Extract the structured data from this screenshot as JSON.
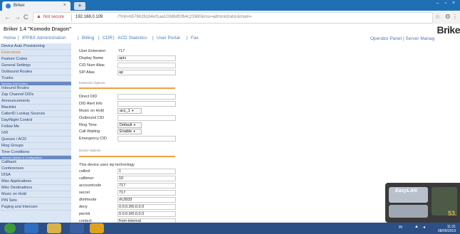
{
  "browser": {
    "tab_title": "Briker",
    "tab_close": "×",
    "new_tab": "+",
    "window_controls": "– ▫ ×",
    "nav_back": "←",
    "nav_forward": "→",
    "nav_reload": "C",
    "security_icon": "▲",
    "not_secure": "Not secure",
    "url_host": "192.168.0.109",
    "url_path": "/?mit=b576b261b4ef1aa100d6dfcf64c239d0&mu=administrator&main=",
    "star_icon": "☆",
    "account_icon": "Θ",
    "menu_icon": "⋮"
  },
  "header": {
    "app_title": "Briker 1.4 \"Komodo Dragon\"",
    "logo_text": "Brike",
    "nav": [
      {
        "label": "Home"
      },
      {
        "label": "IPPBX Administration"
      },
      {
        "label": "Billing"
      },
      {
        "label": "CDR"
      },
      {
        "label": "ACD Statistics"
      },
      {
        "label": "User Portal"
      },
      {
        "label": "Fax"
      }
    ],
    "nav_separator": "|",
    "operator_panel": "Operator Panel",
    "server_manager": "Server Manag"
  },
  "sidebar": {
    "items": [
      {
        "label": "Device Auto Provisioning",
        "kind": "item"
      },
      {
        "label": "Extensions",
        "kind": "active"
      },
      {
        "label": "Feature Codes",
        "kind": "item"
      },
      {
        "label": "General Settings",
        "kind": "item"
      },
      {
        "label": "Outbound Routes",
        "kind": "item"
      },
      {
        "label": "Trunks",
        "kind": "item"
      },
      {
        "label": "Inbound Call Control",
        "kind": "head"
      },
      {
        "label": "Inbound Routes",
        "kind": "item"
      },
      {
        "label": "Zap Channel DIDs",
        "kind": "item"
      },
      {
        "label": "Announcements",
        "kind": "item"
      },
      {
        "label": "Blacklist",
        "kind": "item"
      },
      {
        "label": "CallerID Lookup Sources",
        "kind": "item"
      },
      {
        "label": "Day/Night Control",
        "kind": "item"
      },
      {
        "label": "Follow Me",
        "kind": "item"
      },
      {
        "label": "IVR",
        "kind": "item"
      },
      {
        "label": "Queues / ACD",
        "kind": "item"
      },
      {
        "label": "Ring Groups",
        "kind": "item"
      },
      {
        "label": "Time Conditions",
        "kind": "item"
      },
      {
        "label": "Internal Options & Configuration",
        "kind": "head"
      },
      {
        "label": "Callback",
        "kind": "item"
      },
      {
        "label": "Conferences",
        "kind": "item"
      },
      {
        "label": "DISA",
        "kind": "item"
      },
      {
        "label": "Misc Applications",
        "kind": "item"
      },
      {
        "label": "Misc Destinations",
        "kind": "item"
      },
      {
        "label": "Music on Hold",
        "kind": "item"
      },
      {
        "label": "PIN Sets",
        "kind": "item"
      },
      {
        "label": "Paging and Intercom",
        "kind": "item"
      }
    ]
  },
  "form": {
    "user_extension": {
      "label": "User Extension",
      "value": "717"
    },
    "display_name": {
      "label": "Display Name",
      "value": "apis"
    },
    "cid_num_alias": {
      "label": "CID Num Alias",
      "value": ""
    },
    "sip_alias": {
      "label": "SIP Alias",
      "value": "ap"
    },
    "extension_options_title": "Extension Options",
    "direct_did": {
      "label": "Direct DID",
      "value": ""
    },
    "did_alert_info": {
      "label": "DID Alert Info",
      "value": ""
    },
    "music_on_hold": {
      "label": "Music on Hold",
      "value": "acc_1"
    },
    "outbound_cid": {
      "label": "Outbound CID",
      "value": ""
    },
    "ring_time": {
      "label": "Ring Time",
      "value": "Default"
    },
    "call_waiting": {
      "label": "Call Waiting",
      "value": "Enable"
    },
    "emergency_cid": {
      "label": "Emergency CID",
      "value": ""
    },
    "device_options_title": "Device Options",
    "device_tech_text": "This device uses sip technology.",
    "callinit": {
      "label": "callinit",
      "value": "1"
    },
    "calltimer": {
      "label": "calltimer",
      "value": "10"
    },
    "accountcode": {
      "label": "accountcode",
      "value": "717"
    },
    "secret": {
      "label": "secret",
      "value": "717"
    },
    "dtmfmode": {
      "label": "dtmfmode",
      "value": "rfc2833"
    },
    "deny": {
      "label": "deny",
      "value": "0.0.0.0/0.0.0.0"
    },
    "permit": {
      "label": "permit",
      "value": "0.0.0.0/0.0.0.0"
    },
    "context": {
      "label": "context",
      "value": "from-internal"
    },
    "dropdown_arrow": "▼"
  },
  "widget": {
    "brand": "EasyLAN",
    "value": "53."
  },
  "taskbar": {
    "time": "11:31",
    "date": "08/09/2019",
    "lang": "IN"
  },
  "colors": {
    "accent": "#e07a1a",
    "sidebar_bg": "#dbe6f4",
    "link": "#4f7bb8",
    "taskbar": "#2c4f86"
  }
}
